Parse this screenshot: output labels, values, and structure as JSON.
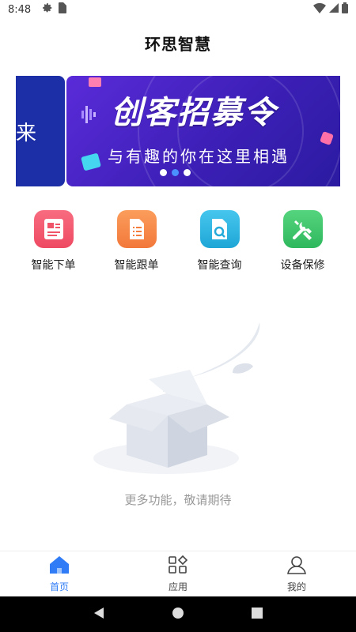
{
  "status_bar": {
    "time": "8:48",
    "left_icons": [
      "settings-icon",
      "sim-card-icon"
    ],
    "right_icons": [
      "wifi-icon",
      "signal-icon",
      "battery-icon"
    ]
  },
  "header": {
    "title": "环思智慧"
  },
  "banner": {
    "prev_slide_text": "来",
    "headline": "创客招募令",
    "subtitle": "与有趣的你在这里相遇",
    "slide_count": 3,
    "active_slide": 1
  },
  "features": [
    {
      "label": "智能下单",
      "icon": "order-document-icon",
      "color": "#f0566e"
    },
    {
      "label": "智能跟单",
      "icon": "tracking-list-icon",
      "color": "#f6894a"
    },
    {
      "label": "智能查询",
      "icon": "search-document-icon",
      "color": "#2fb3e0"
    },
    {
      "label": "设备保修",
      "icon": "repair-tools-icon",
      "color": "#3dc46c"
    }
  ],
  "empty_state": {
    "illustration": "open-box-icon",
    "message": "更多功能，敬请期待"
  },
  "tab_bar": {
    "tabs": [
      {
        "label": "首页",
        "icon": "home-icon",
        "active": true
      },
      {
        "label": "应用",
        "icon": "apps-icon",
        "active": false
      },
      {
        "label": "我的",
        "icon": "profile-icon",
        "active": false
      }
    ]
  },
  "system_nav": [
    "back-icon",
    "home-circle-icon",
    "recents-icon"
  ],
  "colors": {
    "accent": "#2f7cf6",
    "banner_bg": "#4a25c8"
  }
}
